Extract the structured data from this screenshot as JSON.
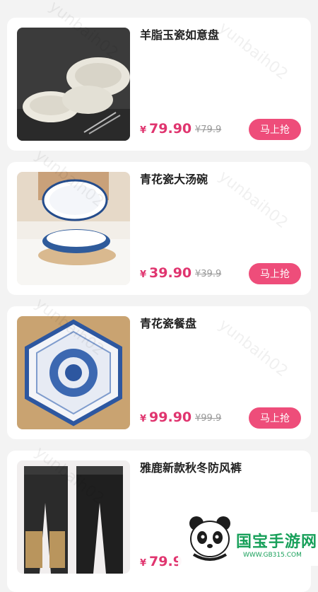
{
  "products": [
    {
      "title": "羊脂玉瓷如意盘",
      "currency": "¥",
      "price": "79.90",
      "original_price": "¥79.9",
      "button": "马上抢"
    },
    {
      "title": "青花瓷大汤碗",
      "currency": "¥",
      "price": "39.90",
      "original_price": "¥39.9",
      "button": "马上抢"
    },
    {
      "title": "青花瓷餐盘",
      "currency": "¥",
      "price": "99.90",
      "original_price": "¥99.9",
      "button": "马上抢"
    },
    {
      "title": "雅鹿新款秋冬防风裤",
      "currency": "¥",
      "price": "79.9",
      "original_price": "",
      "button": ""
    }
  ],
  "watermark": "yunbaih02",
  "brand_logo": {
    "name": "国宝手游网",
    "url": "WWW.GB315.COM"
  }
}
